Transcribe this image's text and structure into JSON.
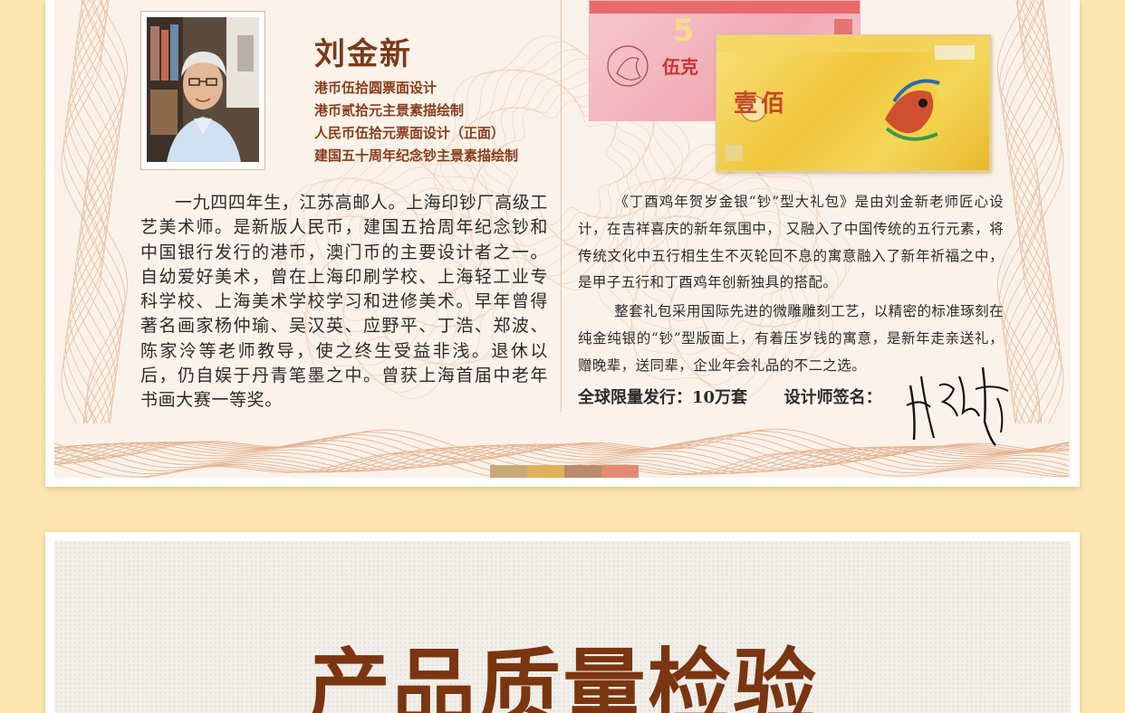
{
  "designer": {
    "name": "刘金新",
    "titles": [
      "港币伍拾圆票面设计",
      "港币贰拾元主景素描绘制",
      "人民币伍拾元票面设计（正面）",
      "建国五十周年纪念钞主景素描绘制"
    ],
    "bio": "一九四四年生，江苏高邮人。上海印钞厂高级工艺美术师。是新版人民币，建国五拾周年纪念钞和中国银行发行的港币，澳门币的主要设计者之一。自幼爱好美术，曾在上海印刷学校、上海轻工业专科学校、上海美术学校学习和进修美术。早年曾得著名画家杨仲瑜、吴汉英、应野平、丁浩、郑波、陈家泠等老师教导，使之终生受益非浅。退休以后，仍自娱于丹青笔墨之中。曾获上海首届中老年书画大赛一等奖。"
  },
  "product": {
    "description": [
      "《丁酉鸡年贺岁金银“钞”型大礼包》是由刘金新老师匠心设计，在吉祥喜庆的新年氛围中， 又融入了中国传统的五行元素，将传统文化中五行相生生不灭轮回不息的寓意融入了新年祈福之中，是甲子五行和丁酉鸡年创新独具的搭配。",
      "整套礼包采用国际先进的微雕雕刻工艺，以精密的标准琢刻在纯金纯银的“钞”型版面上，有着压岁钱的寓意，是新年走亲送礼，赠晚辈，送同辈，企业年会礼品的不二之选。"
    ],
    "circulation_label": "全球限量发行：10万套",
    "signature_label": "设计师签名：",
    "note_pink_text": "伍克",
    "note_gold_text": "壹佰"
  },
  "section2": {
    "heading": "产品质量检验"
  },
  "colors": {
    "page_bg": "#fde6b2",
    "guilloche": "#dfa47a",
    "heading": "#7b3510",
    "titles": "#8a3c1a",
    "colorbar": [
      "#c9a87a",
      "#e0b05a",
      "#b98a6e",
      "#e58a72"
    ]
  }
}
